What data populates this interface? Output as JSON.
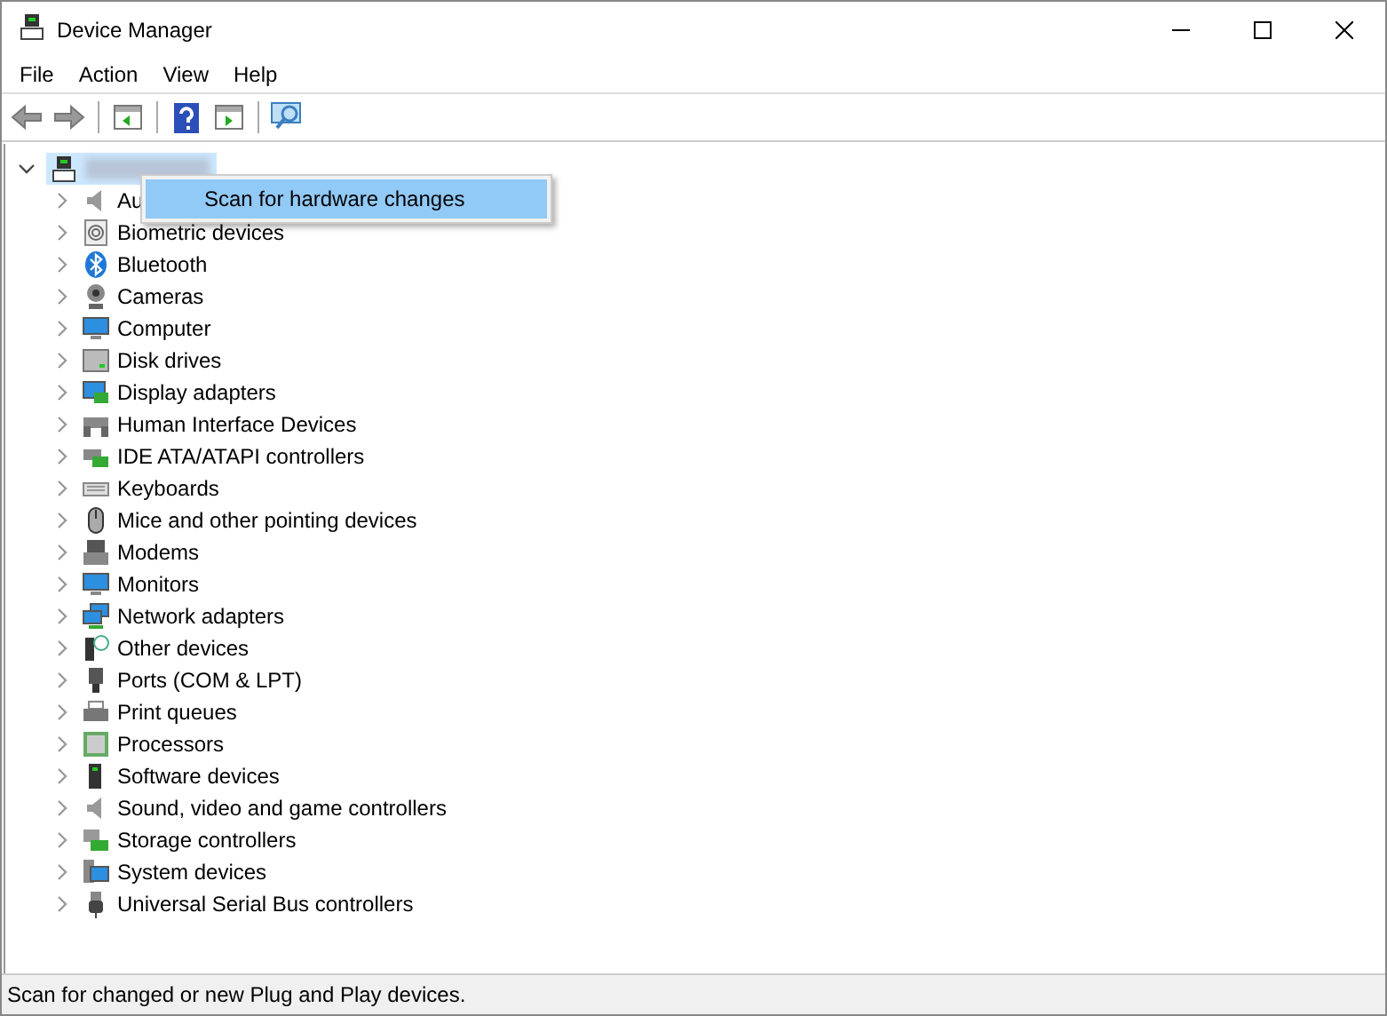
{
  "window": {
    "title": "Device Manager"
  },
  "menu_bar": [
    "File",
    "Action",
    "View",
    "Help"
  ],
  "tree": {
    "expanded": true,
    "selected": true,
    "children": [
      {
        "label": "Au",
        "expanded": false
      },
      {
        "label": "Biometric devices",
        "expanded": false
      },
      {
        "label": "Bluetooth",
        "expanded": false
      },
      {
        "label": "Cameras",
        "expanded": false
      },
      {
        "label": "Computer",
        "expanded": false
      },
      {
        "label": "Disk drives",
        "expanded": false
      },
      {
        "label": "Display adapters",
        "expanded": false
      },
      {
        "label": "Human Interface Devices",
        "expanded": false
      },
      {
        "label": "IDE ATA/ATAPI controllers",
        "expanded": false
      },
      {
        "label": "Keyboards",
        "expanded": false
      },
      {
        "label": "Mice and other pointing devices",
        "expanded": false
      },
      {
        "label": "Modems",
        "expanded": false
      },
      {
        "label": "Monitors",
        "expanded": false
      },
      {
        "label": "Network adapters",
        "expanded": false
      },
      {
        "label": "Other devices",
        "expanded": false
      },
      {
        "label": "Ports (COM & LPT)",
        "expanded": false
      },
      {
        "label": "Print queues",
        "expanded": false
      },
      {
        "label": "Processors",
        "expanded": false
      },
      {
        "label": "Software devices",
        "expanded": false
      },
      {
        "label": "Sound, video and game controllers",
        "expanded": false
      },
      {
        "label": "Storage controllers",
        "expanded": false
      },
      {
        "label": "System devices",
        "expanded": false
      },
      {
        "label": "Universal Serial Bus controllers",
        "expanded": false
      }
    ]
  },
  "context_menu": {
    "items": [
      {
        "label": "Scan for hardware changes",
        "selected": true
      }
    ]
  },
  "status_bar": "Scan for changed or new Plug and Play devices."
}
